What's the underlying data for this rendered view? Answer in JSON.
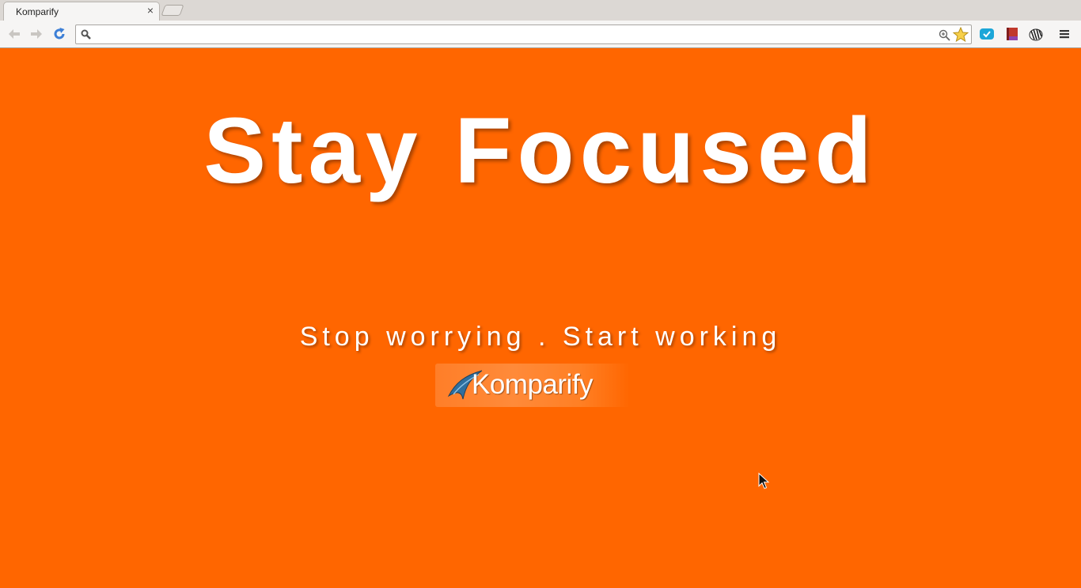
{
  "browser": {
    "tab_title": "Komparify",
    "tab_close": "×",
    "address_value": ""
  },
  "page": {
    "headline": "Stay Focused",
    "tagline": "Stop worrying . Start working",
    "logo_text": "Komparify"
  },
  "colors": {
    "background": "#ff6600",
    "text": "#ffffff"
  },
  "icons": [
    "back-arrow-icon",
    "forward-arrow-icon",
    "reload-icon",
    "search-icon",
    "zoom-icon",
    "star-icon",
    "pocket-extension-icon",
    "book-extension-icon",
    "zebra-extension-icon",
    "menu-icon",
    "mouse-cursor-icon"
  ]
}
